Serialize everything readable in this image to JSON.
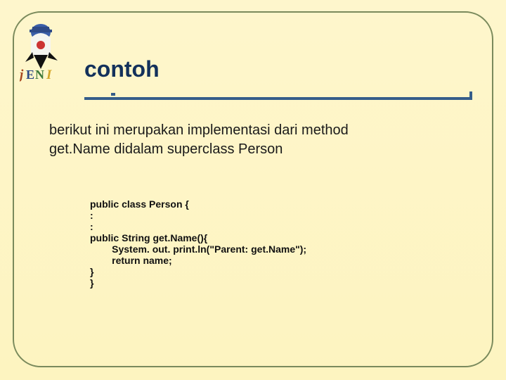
{
  "title": "contoh",
  "desc_line1": "berikut ini merupakan implementasi dari method",
  "desc_line2": "get.Name didalam superclass Person",
  "code": {
    "l1": "public class Person {",
    "l2": ":",
    "l3": ":",
    "l4": "public String get.Name(){",
    "l5": "        System. out. print.ln(\"Parent: get.Name\");",
    "l6": "        return name;",
    "l7": "}",
    "l8": "}"
  },
  "icons": {
    "jeni": "jeni-logo"
  }
}
